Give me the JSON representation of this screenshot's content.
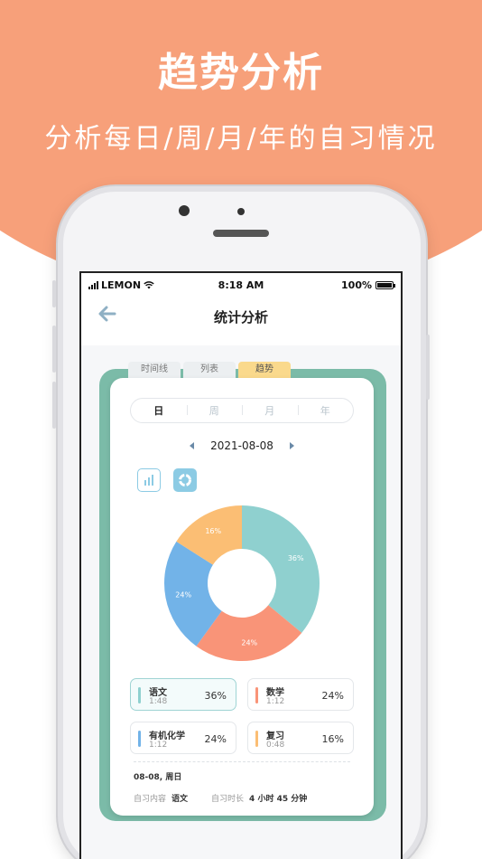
{
  "promo": {
    "title": "趋势分析",
    "subtitle": "分析每日/周/月/年的自习情况"
  },
  "status_bar": {
    "carrier": "LEMON",
    "time": "8:18 AM",
    "battery": "100%"
  },
  "nav": {
    "title": "统计分析",
    "back_icon": "back-arrow-icon"
  },
  "tabs": [
    {
      "label": "时间线",
      "active": false
    },
    {
      "label": "列表",
      "active": false
    },
    {
      "label": "趋势",
      "active": true
    }
  ],
  "period": [
    {
      "label": "日",
      "active": true
    },
    {
      "label": "周",
      "active": false
    },
    {
      "label": "月",
      "active": false
    },
    {
      "label": "年",
      "active": false
    }
  ],
  "date": "2021-08-08",
  "chart_data": {
    "type": "pie",
    "donut": true,
    "categories": [
      "语文",
      "数学",
      "有机化学",
      "复习"
    ],
    "values": [
      36,
      24,
      24,
      16
    ],
    "labels": [
      "36%",
      "24%",
      "24%",
      "16%"
    ],
    "colors": [
      "#8FD0CF",
      "#F99478",
      "#72B3E8",
      "#FBBE74"
    ]
  },
  "subjects": [
    {
      "name": "语文",
      "time": "1:48",
      "pct": "36%",
      "color": "#8FD0CF",
      "active": true
    },
    {
      "name": "数学",
      "time": "1:12",
      "pct": "24%",
      "color": "#F99478",
      "active": false
    },
    {
      "name": "有机化学",
      "time": "1:12",
      "pct": "24%",
      "color": "#72B3E8",
      "active": false
    },
    {
      "name": "复习",
      "time": "0:48",
      "pct": "16%",
      "color": "#FBBE74",
      "active": false
    }
  ],
  "summary": {
    "date": "08-08, 周日",
    "content_label": "自习内容",
    "content_value": "语文",
    "duration_label": "自习时长",
    "duration_value": "4 小时 45 分钟"
  },
  "colors": {
    "promo": "#F7A07A",
    "frame": "#7BBBA8",
    "active_tab": "#FAD98C"
  }
}
